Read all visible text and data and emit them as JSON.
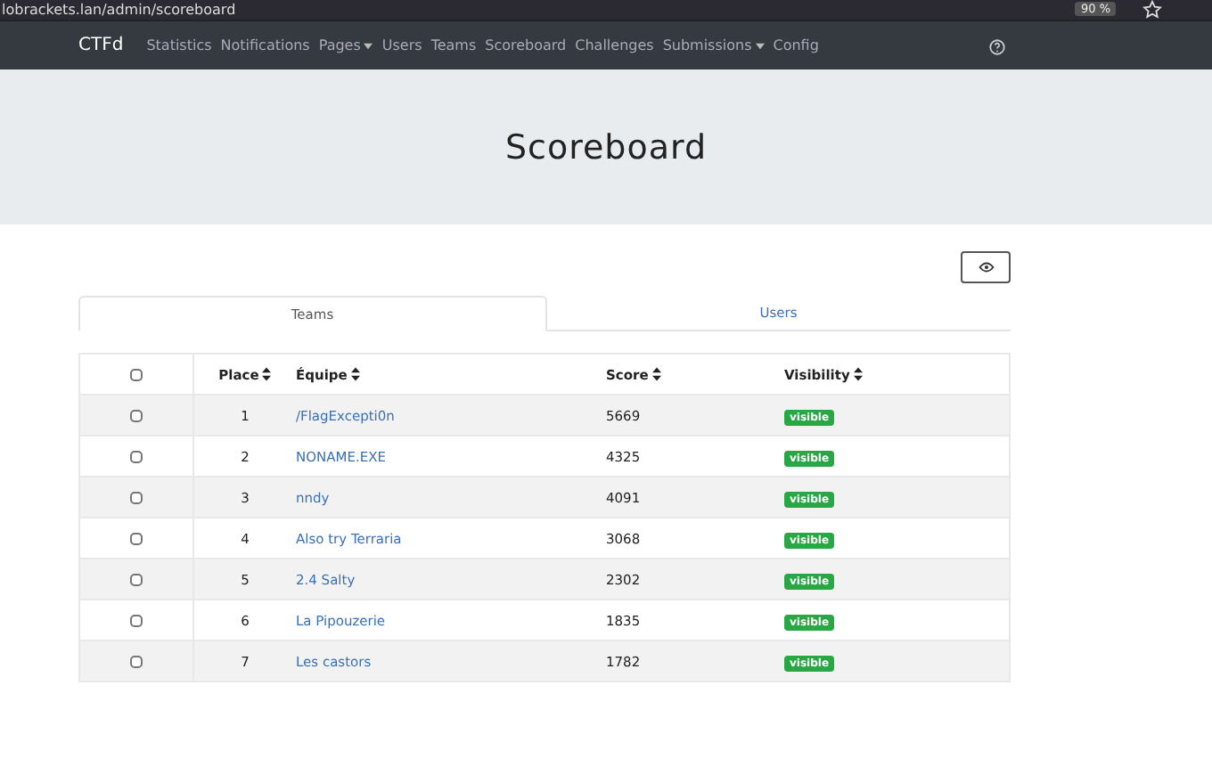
{
  "browser": {
    "url": "lobrackets.lan/admin/scoreboard",
    "zoom": "90 %"
  },
  "navbar": {
    "brand": "CTFd",
    "items": [
      {
        "label": "Statistics",
        "dropdown": false
      },
      {
        "label": "Notifications",
        "dropdown": false
      },
      {
        "label": "Pages",
        "dropdown": true
      },
      {
        "label": "Users",
        "dropdown": false
      },
      {
        "label": "Teams",
        "dropdown": false
      },
      {
        "label": "Scoreboard",
        "dropdown": false
      },
      {
        "label": "Challenges",
        "dropdown": false
      },
      {
        "label": "Submissions",
        "dropdown": true
      },
      {
        "label": "Config",
        "dropdown": false
      }
    ]
  },
  "title": "Scoreboard",
  "tabs": [
    {
      "label": "Teams",
      "selected": true
    },
    {
      "label": "Users",
      "selected": false
    }
  ],
  "table": {
    "select_all_checked": false,
    "columns": [
      "Place",
      "Équipe",
      "Score",
      "Visibility"
    ],
    "rows": [
      {
        "checked": false,
        "place": "1",
        "team": "/FlagExcepti0n",
        "score": "5669",
        "visibility": "visible"
      },
      {
        "checked": false,
        "place": "2",
        "team": "NONAME.EXE",
        "score": "4325",
        "visibility": "visible"
      },
      {
        "checked": false,
        "place": "3",
        "team": "nndy",
        "score": "4091",
        "visibility": "visible"
      },
      {
        "checked": false,
        "place": "4",
        "team": "Also try Terraria",
        "score": "3068",
        "visibility": "visible"
      },
      {
        "checked": false,
        "place": "5",
        "team": "2.4 Salty",
        "score": "2302",
        "visibility": "visible"
      },
      {
        "checked": false,
        "place": "6",
        "team": "La Pipouzerie",
        "score": "1835",
        "visibility": "visible"
      },
      {
        "checked": false,
        "place": "7",
        "team": "Les castors",
        "score": "1782",
        "visibility": "visible"
      }
    ]
  }
}
